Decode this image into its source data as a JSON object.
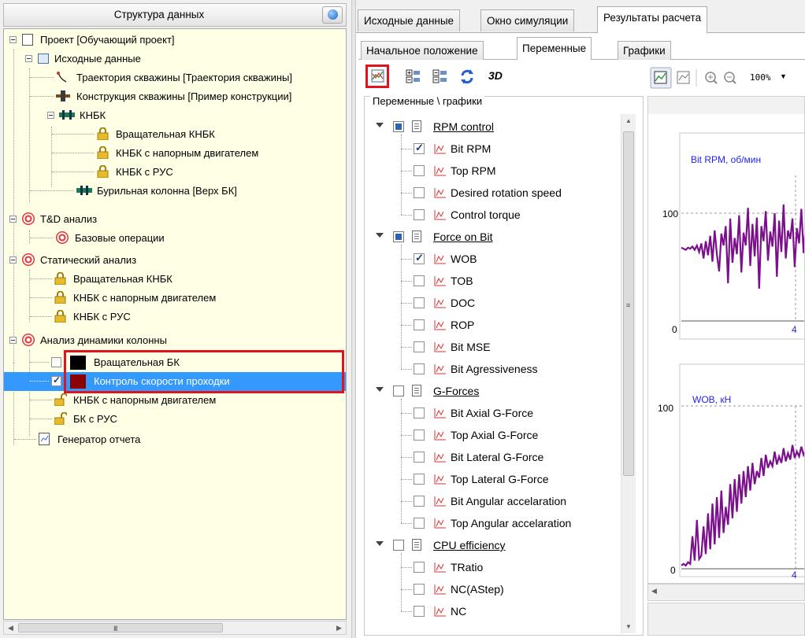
{
  "left_panel": {
    "title": "Структура данных",
    "tree": [
      {
        "label": "Проект [Обучающий проект]",
        "icon": "project-icon"
      },
      {
        "label": "Исходные данные",
        "icon": "source-data-icon"
      },
      {
        "label": "Траектория скважины [Траектория скважины]",
        "icon": "trajectory-icon"
      },
      {
        "label": "Конструкция скважины [Пример конструкции]",
        "icon": "well-construction-icon"
      },
      {
        "label": "КНБК",
        "icon": "bha-icon"
      },
      {
        "label": "Вращательная КНБК",
        "icon": "lock-icon"
      },
      {
        "label": "КНБК с напорным двигателем",
        "icon": "lock-icon"
      },
      {
        "label": "КНБК с РУС",
        "icon": "lock-icon"
      },
      {
        "label": "Бурильная колонна [Верх БК]",
        "icon": "drill-string-icon"
      },
      {
        "label": "T&D анализ",
        "icon": "target-icon"
      },
      {
        "label": "Базовые операции",
        "icon": "target-icon"
      },
      {
        "label": "Статический анализ",
        "icon": "target-icon"
      },
      {
        "label": "Вращательная КНБК",
        "icon": "lock-icon"
      },
      {
        "label": "КНБК с напорным двигателем",
        "icon": "lock-icon"
      },
      {
        "label": "КНБК с РУС",
        "icon": "lock-icon"
      },
      {
        "label": "Анализ динамики колонны",
        "icon": "target-icon"
      },
      {
        "label": "Вращательная БК",
        "checked": false,
        "swatch": "#000000"
      },
      {
        "label": "Контроль скорости проходки",
        "checked": true,
        "swatch": "#8b0000"
      },
      {
        "label": "КНБК с напорным двигателем",
        "icon": "unlock-icon"
      },
      {
        "label": "БК с РУС",
        "icon": "unlock-icon"
      },
      {
        "label": "Генератор отчета",
        "icon": "report-icon"
      }
    ]
  },
  "tabs": {
    "main": [
      "Исходные данные",
      "Окно симуляции",
      "Результаты расчета"
    ],
    "main_active": "Результаты расчета",
    "sub": [
      "Начальное положение",
      "Переменные",
      "Графики"
    ],
    "sub_active": "Переменные"
  },
  "variables": {
    "toolbar_3d_label": "3D",
    "group_label": "Переменные \\ графики",
    "groups": [
      {
        "label": "RPM control",
        "group_checked": true,
        "items": [
          {
            "label": "Bit RPM",
            "checked": true
          },
          {
            "label": "Top RPM",
            "checked": false
          },
          {
            "label": "Desired rotation speed",
            "checked": false
          },
          {
            "label": "Control torque",
            "checked": false
          }
        ]
      },
      {
        "label": "Force on Bit",
        "group_checked": true,
        "items": [
          {
            "label": "WOB",
            "checked": true
          },
          {
            "label": "TOB",
            "checked": false
          },
          {
            "label": "DOC",
            "checked": false
          },
          {
            "label": "ROP",
            "checked": false
          },
          {
            "label": "Bit MSE",
            "checked": false
          },
          {
            "label": "Bit Agressiveness",
            "checked": false
          }
        ]
      },
      {
        "label": "G-Forces",
        "group_checked": false,
        "items": [
          {
            "label": "Bit Axial G-Force",
            "checked": false
          },
          {
            "label": "Top Axial G-Force",
            "checked": false
          },
          {
            "label": "Bit Lateral G-Force",
            "checked": false
          },
          {
            "label": "Top Lateral G-Force",
            "checked": false
          },
          {
            "label": "Bit Angular accelaration",
            "checked": false
          },
          {
            "label": "Top Angular accelaration",
            "checked": false
          }
        ]
      },
      {
        "label": "CPU efficiency",
        "group_checked": false,
        "items": [
          {
            "label": "TRatio",
            "checked": false
          },
          {
            "label": "NC(AStep)",
            "checked": false
          },
          {
            "label": "NC",
            "checked": false
          }
        ]
      }
    ]
  },
  "chart_toolbar": {
    "zoom": "100%"
  },
  "colors": {
    "series": "#7b0f8c",
    "selection": "#3399ff",
    "highlight_box": "#e0141e",
    "tree_bg": "#ffffe6"
  },
  "chart_data": [
    {
      "type": "line",
      "ylabel": "Bit RPM, об/мин",
      "xticks": [
        4
      ],
      "yticks": [
        0,
        100
      ],
      "series": [
        {
          "values": [
            68,
            67,
            66,
            68,
            67,
            69,
            66,
            70,
            64,
            72,
            58,
            74,
            61,
            79,
            55,
            84,
            62,
            46,
            81,
            70,
            88,
            35,
            95,
            54,
            77,
            62,
            98,
            45,
            82,
            70,
            105,
            51,
            90,
            60,
            96,
            30,
            88,
            74,
            102,
            56,
            83,
            69,
            100,
            41,
            93,
            64,
            108,
            58,
            84,
            76,
            95,
            50,
            86,
            72,
            104,
            63,
            91
          ]
        }
      ]
    },
    {
      "type": "line",
      "ylabel": "WOB, кН",
      "xticks": [
        4
      ],
      "yticks": [
        0,
        100
      ],
      "series": [
        {
          "values": [
            2,
            3,
            2,
            4,
            3,
            20,
            5,
            30,
            6,
            8,
            26,
            9,
            34,
            12,
            40,
            15,
            44,
            19,
            48,
            22,
            38,
            27,
            52,
            31,
            55,
            35,
            58,
            40,
            60,
            44,
            63,
            48,
            65,
            52,
            60,
            56,
            68,
            57,
            70,
            62,
            66,
            63,
            72,
            64,
            69,
            65,
            74,
            66,
            71,
            67,
            76,
            68,
            72,
            69,
            75,
            70,
            73
          ]
        }
      ]
    }
  ]
}
